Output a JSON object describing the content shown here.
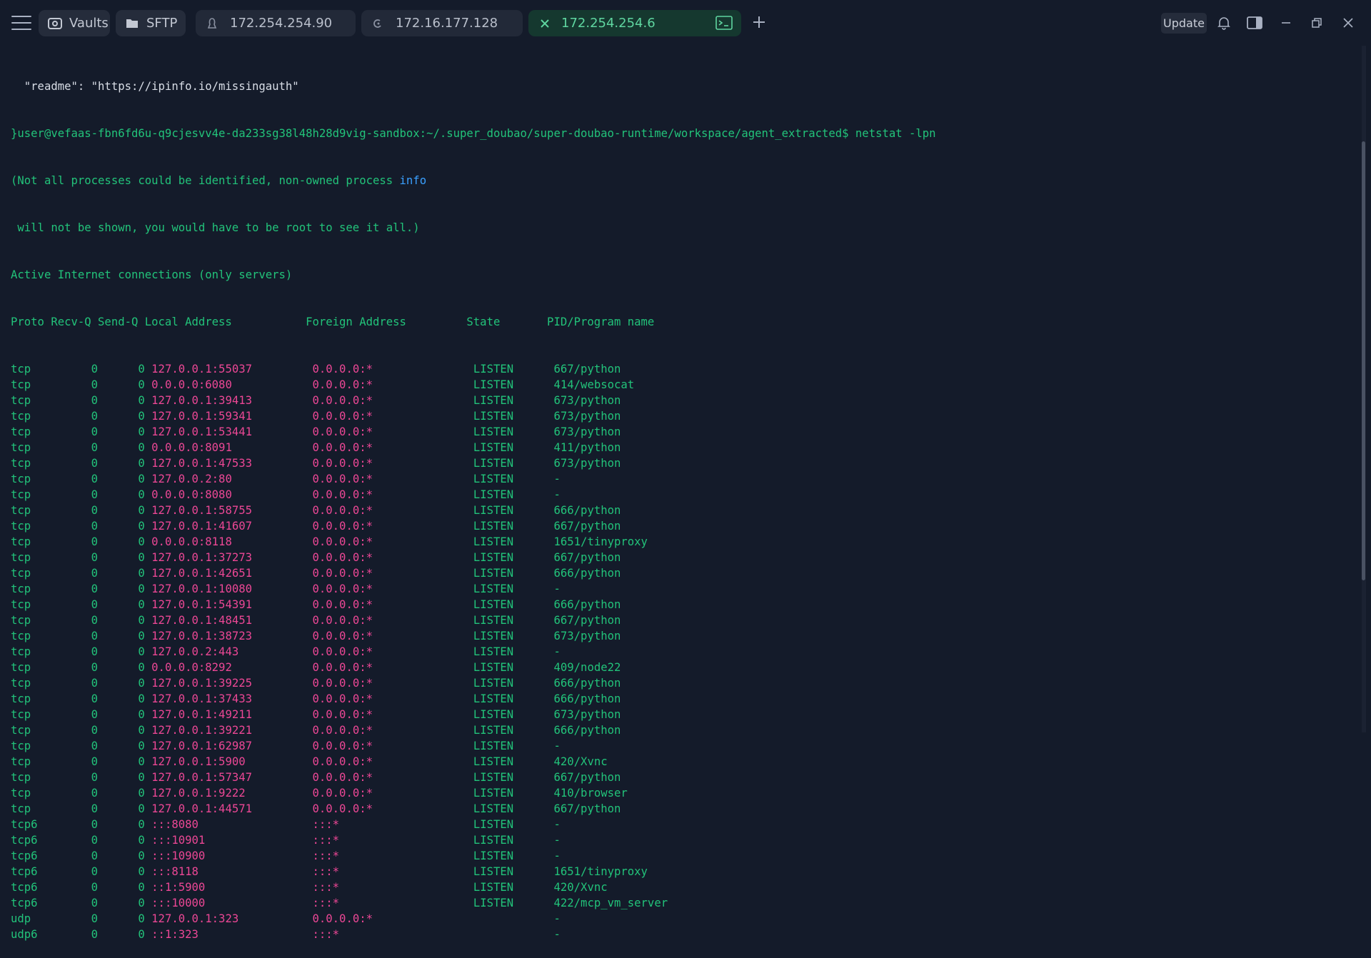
{
  "toolbar": {
    "vaults_label": "Vaults",
    "sftp_label": "SFTP",
    "update_label": "Update"
  },
  "tabs": [
    {
      "label": "172.254.254.90"
    },
    {
      "label": "172.16.177.128"
    },
    {
      "label": "172.254.254.6",
      "active": true
    }
  ],
  "colors": {
    "background": "#141b2a",
    "terminal_green": "#22c37a",
    "ip_magenta": "#ec4795",
    "keyword_blue": "#3aa0ff",
    "active_tab_bg": "#15382f"
  },
  "icons": [
    "menu-icon",
    "vault-icon",
    "folder-icon",
    "linux-icon",
    "debian-icon",
    "close-icon",
    "terminal-icon",
    "plus-icon",
    "bell-icon",
    "sidepanel-icon",
    "minimize-icon",
    "restore-icon",
    "window-close-icon"
  ],
  "terminal": {
    "pre_lines": [
      "  \"readme\": \"https://ipinfo.io/missingauth\"",
      "}user@vefaas-fbn6fd6u-q9cjesvv4e-da233sg38l48h28d9vig-sandbox:~/.super_doubao/super-doubao-runtime/workspace/agent_extracted$ netstat -lpn",
      "(Not all processes could be identified, non-owned process ",
      " will not be shown, you would have to be root to see it all.)",
      "Active Internet connections (only servers)",
      "Proto Recv-Q Send-Q Local Address           Foreign Address         State       PID/Program name"
    ],
    "info_word": "info",
    "rows": [
      {
        "proto": "tcp",
        "recvq": "0",
        "sendq": "0",
        "local": "127.0.0.1:55037",
        "foreign": "0.0.0.0:*",
        "state": "LISTEN",
        "pid": "667/python"
      },
      {
        "proto": "tcp",
        "recvq": "0",
        "sendq": "0",
        "local": "0.0.0.0:6080",
        "foreign": "0.0.0.0:*",
        "state": "LISTEN",
        "pid": "414/websocat"
      },
      {
        "proto": "tcp",
        "recvq": "0",
        "sendq": "0",
        "local": "127.0.0.1:39413",
        "foreign": "0.0.0.0:*",
        "state": "LISTEN",
        "pid": "673/python"
      },
      {
        "proto": "tcp",
        "recvq": "0",
        "sendq": "0",
        "local": "127.0.0.1:59341",
        "foreign": "0.0.0.0:*",
        "state": "LISTEN",
        "pid": "673/python"
      },
      {
        "proto": "tcp",
        "recvq": "0",
        "sendq": "0",
        "local": "127.0.0.1:53441",
        "foreign": "0.0.0.0:*",
        "state": "LISTEN",
        "pid": "673/python"
      },
      {
        "proto": "tcp",
        "recvq": "0",
        "sendq": "0",
        "local": "0.0.0.0:8091",
        "foreign": "0.0.0.0:*",
        "state": "LISTEN",
        "pid": "411/python"
      },
      {
        "proto": "tcp",
        "recvq": "0",
        "sendq": "0",
        "local": "127.0.0.1:47533",
        "foreign": "0.0.0.0:*",
        "state": "LISTEN",
        "pid": "673/python"
      },
      {
        "proto": "tcp",
        "recvq": "0",
        "sendq": "0",
        "local": "127.0.0.2:80",
        "foreign": "0.0.0.0:*",
        "state": "LISTEN",
        "pid": "-"
      },
      {
        "proto": "tcp",
        "recvq": "0",
        "sendq": "0",
        "local": "0.0.0.0:8080",
        "foreign": "0.0.0.0:*",
        "state": "LISTEN",
        "pid": "-"
      },
      {
        "proto": "tcp",
        "recvq": "0",
        "sendq": "0",
        "local": "127.0.0.1:58755",
        "foreign": "0.0.0.0:*",
        "state": "LISTEN",
        "pid": "666/python"
      },
      {
        "proto": "tcp",
        "recvq": "0",
        "sendq": "0",
        "local": "127.0.0.1:41607",
        "foreign": "0.0.0.0:*",
        "state": "LISTEN",
        "pid": "667/python"
      },
      {
        "proto": "tcp",
        "recvq": "0",
        "sendq": "0",
        "local": "0.0.0.0:8118",
        "foreign": "0.0.0.0:*",
        "state": "LISTEN",
        "pid": "1651/tinyproxy"
      },
      {
        "proto": "tcp",
        "recvq": "0",
        "sendq": "0",
        "local": "127.0.0.1:37273",
        "foreign": "0.0.0.0:*",
        "state": "LISTEN",
        "pid": "667/python"
      },
      {
        "proto": "tcp",
        "recvq": "0",
        "sendq": "0",
        "local": "127.0.0.1:42651",
        "foreign": "0.0.0.0:*",
        "state": "LISTEN",
        "pid": "666/python"
      },
      {
        "proto": "tcp",
        "recvq": "0",
        "sendq": "0",
        "local": "127.0.0.1:10080",
        "foreign": "0.0.0.0:*",
        "state": "LISTEN",
        "pid": "-"
      },
      {
        "proto": "tcp",
        "recvq": "0",
        "sendq": "0",
        "local": "127.0.0.1:54391",
        "foreign": "0.0.0.0:*",
        "state": "LISTEN",
        "pid": "666/python"
      },
      {
        "proto": "tcp",
        "recvq": "0",
        "sendq": "0",
        "local": "127.0.0.1:48451",
        "foreign": "0.0.0.0:*",
        "state": "LISTEN",
        "pid": "667/python"
      },
      {
        "proto": "tcp",
        "recvq": "0",
        "sendq": "0",
        "local": "127.0.0.1:38723",
        "foreign": "0.0.0.0:*",
        "state": "LISTEN",
        "pid": "673/python"
      },
      {
        "proto": "tcp",
        "recvq": "0",
        "sendq": "0",
        "local": "127.0.0.2:443",
        "foreign": "0.0.0.0:*",
        "state": "LISTEN",
        "pid": "-"
      },
      {
        "proto": "tcp",
        "recvq": "0",
        "sendq": "0",
        "local": "0.0.0.0:8292",
        "foreign": "0.0.0.0:*",
        "state": "LISTEN",
        "pid": "409/node22"
      },
      {
        "proto": "tcp",
        "recvq": "0",
        "sendq": "0",
        "local": "127.0.0.1:39225",
        "foreign": "0.0.0.0:*",
        "state": "LISTEN",
        "pid": "666/python"
      },
      {
        "proto": "tcp",
        "recvq": "0",
        "sendq": "0",
        "local": "127.0.0.1:37433",
        "foreign": "0.0.0.0:*",
        "state": "LISTEN",
        "pid": "666/python"
      },
      {
        "proto": "tcp",
        "recvq": "0",
        "sendq": "0",
        "local": "127.0.0.1:49211",
        "foreign": "0.0.0.0:*",
        "state": "LISTEN",
        "pid": "673/python"
      },
      {
        "proto": "tcp",
        "recvq": "0",
        "sendq": "0",
        "local": "127.0.0.1:39221",
        "foreign": "0.0.0.0:*",
        "state": "LISTEN",
        "pid": "666/python"
      },
      {
        "proto": "tcp",
        "recvq": "0",
        "sendq": "0",
        "local": "127.0.0.1:62987",
        "foreign": "0.0.0.0:*",
        "state": "LISTEN",
        "pid": "-"
      },
      {
        "proto": "tcp",
        "recvq": "0",
        "sendq": "0",
        "local": "127.0.0.1:5900",
        "foreign": "0.0.0.0:*",
        "state": "LISTEN",
        "pid": "420/Xvnc"
      },
      {
        "proto": "tcp",
        "recvq": "0",
        "sendq": "0",
        "local": "127.0.0.1:57347",
        "foreign": "0.0.0.0:*",
        "state": "LISTEN",
        "pid": "667/python"
      },
      {
        "proto": "tcp",
        "recvq": "0",
        "sendq": "0",
        "local": "127.0.0.1:9222",
        "foreign": "0.0.0.0:*",
        "state": "LISTEN",
        "pid": "410/browser"
      },
      {
        "proto": "tcp",
        "recvq": "0",
        "sendq": "0",
        "local": "127.0.0.1:44571",
        "foreign": "0.0.0.0:*",
        "state": "LISTEN",
        "pid": "667/python"
      },
      {
        "proto": "tcp6",
        "recvq": "0",
        "sendq": "0",
        "local": ":::8080",
        "foreign": ":::*",
        "state": "LISTEN",
        "pid": "-"
      },
      {
        "proto": "tcp6",
        "recvq": "0",
        "sendq": "0",
        "local": ":::10901",
        "foreign": ":::*",
        "state": "LISTEN",
        "pid": "-"
      },
      {
        "proto": "tcp6",
        "recvq": "0",
        "sendq": "0",
        "local": ":::10900",
        "foreign": ":::*",
        "state": "LISTEN",
        "pid": "-"
      },
      {
        "proto": "tcp6",
        "recvq": "0",
        "sendq": "0",
        "local": ":::8118",
        "foreign": ":::*",
        "state": "LISTEN",
        "pid": "1651/tinyproxy"
      },
      {
        "proto": "tcp6",
        "recvq": "0",
        "sendq": "0",
        "local": "::1:5900",
        "foreign": ":::*",
        "state": "LISTEN",
        "pid": "420/Xvnc"
      },
      {
        "proto": "tcp6",
        "recvq": "0",
        "sendq": "0",
        "local": ":::10000",
        "foreign": ":::*",
        "state": "LISTEN",
        "pid": "422/mcp_vm_server"
      },
      {
        "proto": "udp",
        "recvq": "0",
        "sendq": "0",
        "local": "127.0.0.1:323",
        "foreign": "0.0.0.0:*",
        "state": "",
        "pid": "-"
      },
      {
        "proto": "udp6",
        "recvq": "0",
        "sendq": "0",
        "local": "::1:323",
        "foreign": ":::*",
        "state": "",
        "pid": "-"
      }
    ]
  }
}
